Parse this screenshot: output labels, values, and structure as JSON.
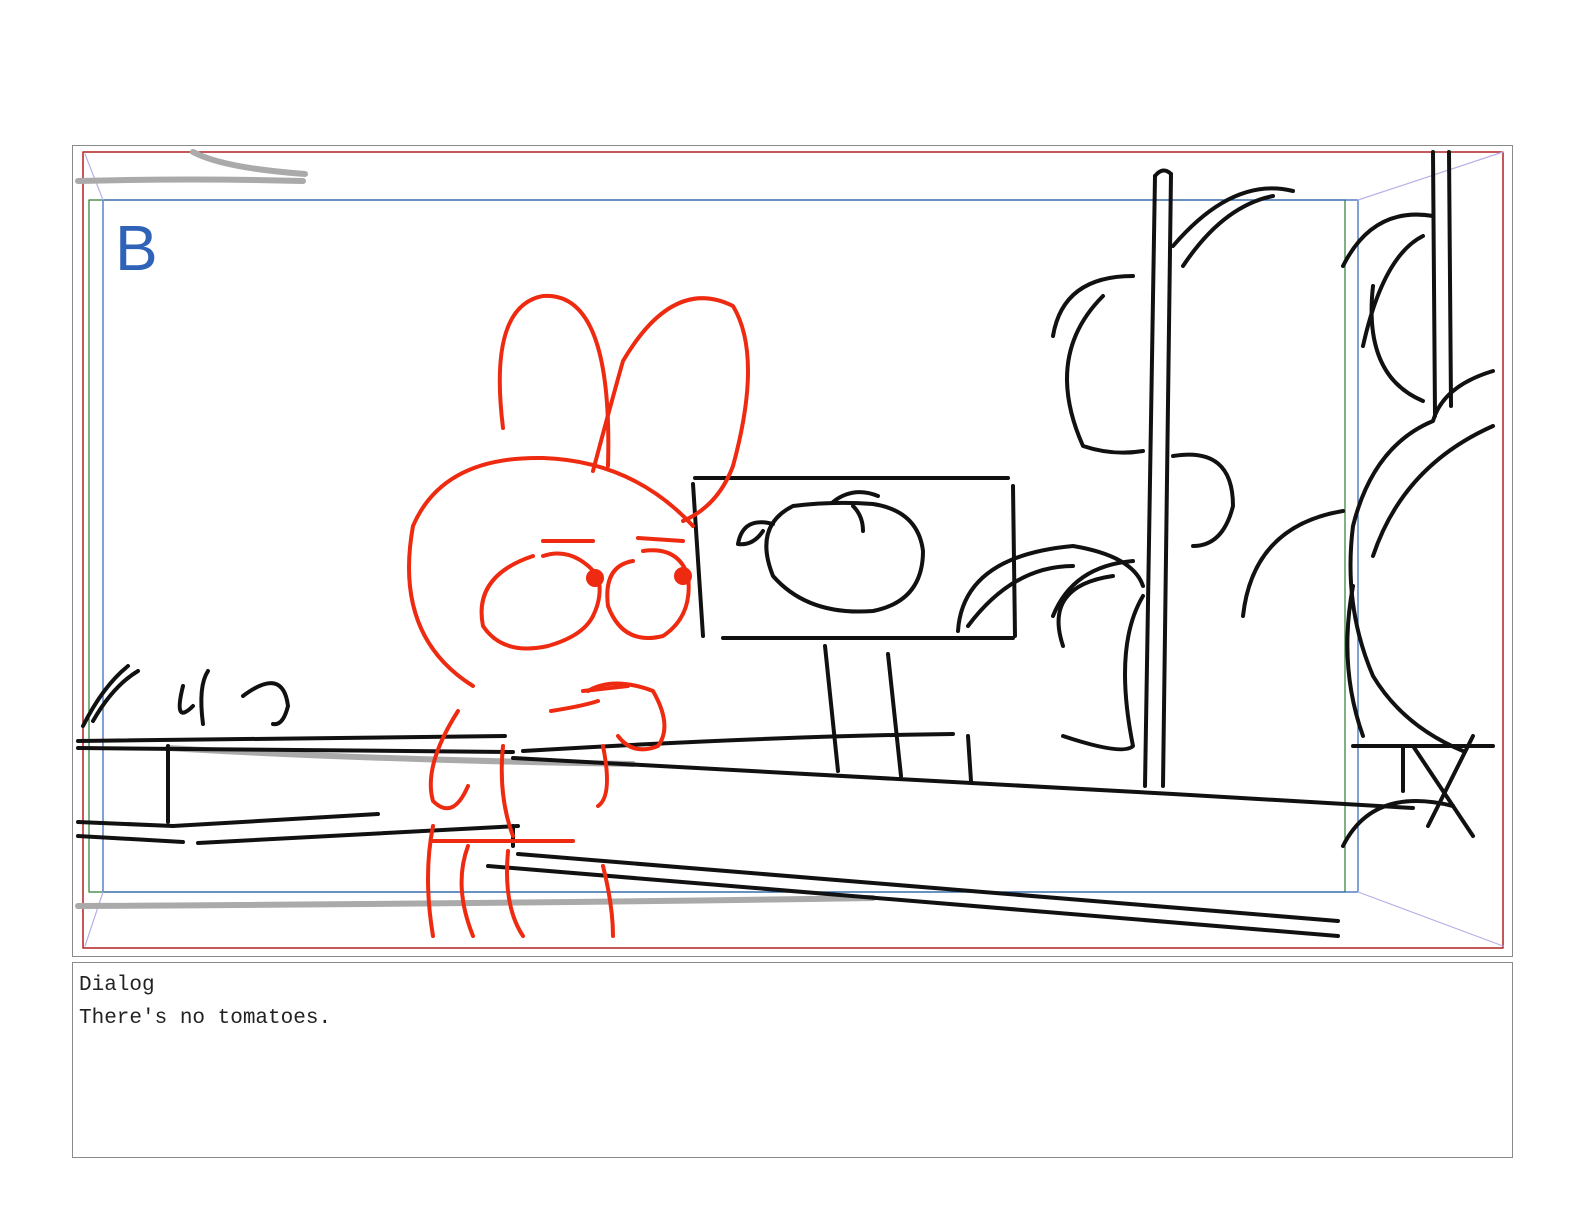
{
  "panel": {
    "letter": "B",
    "colors": {
      "safe_outer": "#b22222",
      "safe_mid": "#2f63b8",
      "safe_inner": "#2e7d32",
      "character": "#ee2a10",
      "ink": "#111111",
      "guide_gray": "#aaaaaa"
    }
  },
  "dialog": {
    "label": "Dialog",
    "text": "There's no tomatoes."
  }
}
